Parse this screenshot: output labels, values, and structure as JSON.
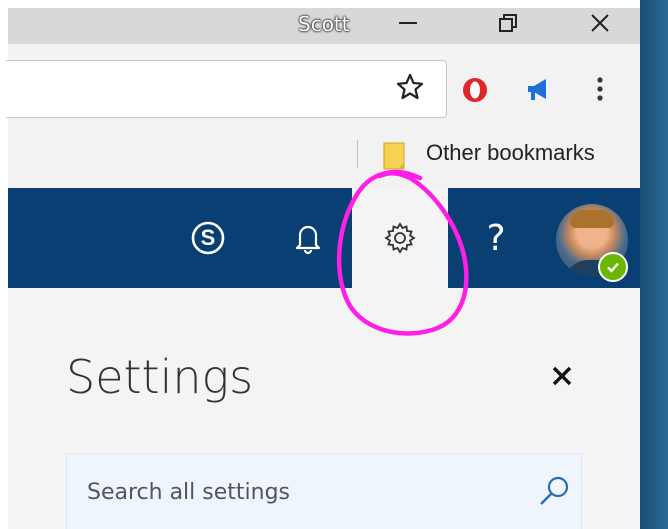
{
  "window": {
    "user_name": "Scott",
    "controls": [
      "minimize-icon",
      "restore-icon",
      "close-icon"
    ]
  },
  "toolbar": {
    "address_value": "",
    "icons": [
      "star-icon",
      "opera-extension-icon",
      "megaphone-extension-icon",
      "more-vert-icon"
    ]
  },
  "bookmarks": {
    "other_label": "Other bookmarks"
  },
  "header": {
    "icons": [
      "skype-icon",
      "bell-icon",
      "gear-icon",
      "help-icon",
      "avatar"
    ],
    "help_glyph": "?",
    "active_icon": "gear-icon",
    "bar_color": "#0a3f73",
    "presence_color": "#6bb700"
  },
  "settings_panel": {
    "title": "Settings",
    "search_placeholder": "Search all settings"
  },
  "annotation": {
    "color": "#ff1ee6"
  }
}
